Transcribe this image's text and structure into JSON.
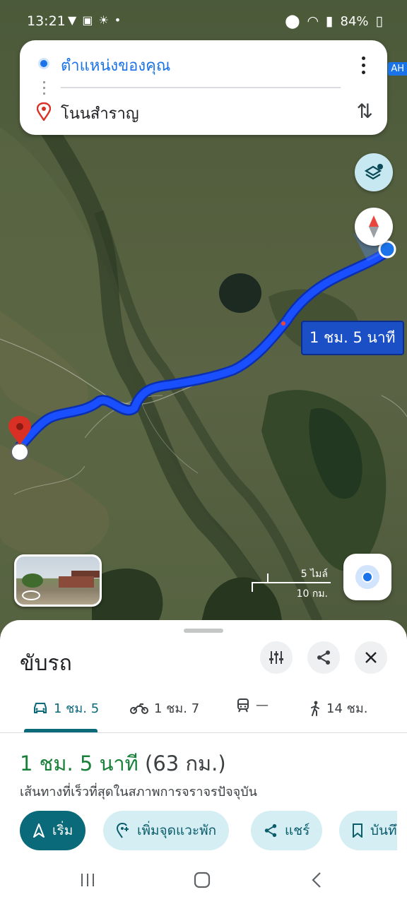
{
  "status_bar": {
    "time": "13:21",
    "battery": "84%"
  },
  "directions": {
    "origin": "ตำแหน่งของคุณ",
    "destination": "โนนสำราญ"
  },
  "map": {
    "route_duration_label": "1 ชม. 5 นาที",
    "road_badge": "AH",
    "scale_imperial": "5 ไมล์",
    "scale_metric": "10 กม."
  },
  "sheet": {
    "title": "ขับรถ",
    "modes": [
      {
        "name": "drive",
        "label": "1 ชม. 5"
      },
      {
        "name": "motorcycle",
        "label": "1 ชม. 7"
      },
      {
        "name": "transit",
        "label": "—"
      },
      {
        "name": "walk",
        "label": "14 ชม."
      }
    ],
    "summary_duration": "1 ชม. 5 นาที",
    "summary_distance": "(63 กม.)",
    "route_description": "เส้นทางที่เร็วที่สุดในสภาพการจราจรปัจจุบัน",
    "actions": {
      "start": "เริ่ม",
      "add_stop": "เพิ่มจุดแวะพัก",
      "share": "แชร์",
      "save": "บันทึ"
    }
  },
  "colors": {
    "accent": "#0b6a7a",
    "route": "#1a4fff",
    "duration_green": "#188038",
    "origin_blue": "#1a73e8",
    "pin_red": "#d93025"
  }
}
